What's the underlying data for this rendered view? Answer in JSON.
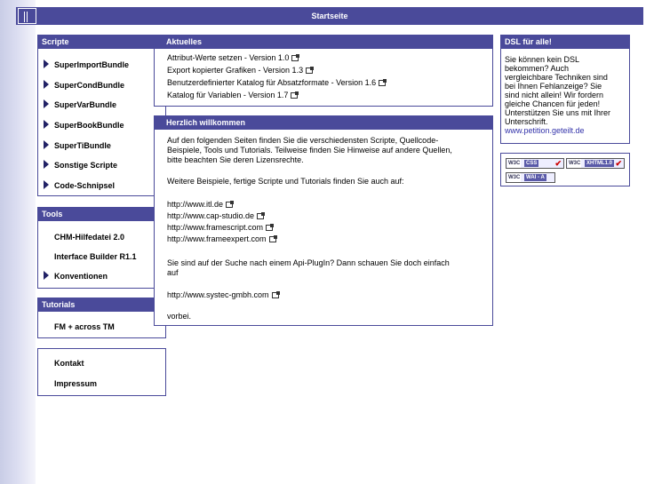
{
  "header": {
    "title": "Startseite"
  },
  "scripte": {
    "heading": "Scripte",
    "items": [
      "SuperImportBundle",
      "SuperCondBundle",
      "SuperVarBundle",
      "SuperBookBundle",
      "SuperTiBundle",
      "Sonstige Scripte",
      "Code-Schnipsel"
    ]
  },
  "tools": {
    "heading": "Tools",
    "items": [
      "CHM-Hilfedatei 2.0",
      "Interface Builder R1.1",
      "Konventionen"
    ]
  },
  "tutorials": {
    "heading": "Tutorials",
    "items": [
      "FM + across TM"
    ]
  },
  "misc": {
    "items": [
      "Kontakt",
      "Impressum"
    ]
  },
  "aktuelles": {
    "heading": "Aktuelles",
    "items": [
      "Attribut-Werte setzen - Version 1.0",
      "Export kopierter Grafiken - Version 1.3",
      "Benutzerdefinierter Katalog für Absatzformate - Version 1.6",
      "Katalog für Variablen - Version 1.7"
    ]
  },
  "willkommen": {
    "heading": "Herzlich willkommen",
    "intro_1": "Auf den folgenden Seiten finden Sie die verschiedensten Scripte, Quellcode-",
    "intro_2": "Beispiele, Tools und Tutorials. Teilweise finden Sie Hinweise auf andere Quellen,",
    "intro_3": "bitte beachten Sie deren Lizensrechte.",
    "more": "Weitere Beispiele, fertige Scripte und Tutorials finden Sie auch auf:",
    "links": [
      "http://www.itl.de",
      "http://www.cap-studio.de",
      "http://www.framescript.com",
      "http://www.frameexpert.com"
    ],
    "plugin_1": "Sie sind auf der Suche nach einem Api-PlugIn? Dann schauen Sie doch einfach",
    "plugin_2": "auf",
    "systec": "http://www.systec-gmbh.com",
    "outro": "vorbei."
  },
  "dsl": {
    "heading": "DSL für alle!",
    "lines": [
      "Sie können kein DSL",
      "bekommen? Auch",
      "vergleichbare Techniken sind",
      "bei Ihnen Fehlanzeige? Sie",
      "sind nicht allein! Wir fordern",
      "gleiche Chancen für jeden!",
      "Unterstützen Sie uns mit Ihrer",
      "Unterschrift."
    ],
    "link": "www.petition.geteilt.de",
    "link_color": "#3333aa"
  },
  "badges": {
    "w3c": "W3C",
    "css": "CSS",
    "xhtml": "XHTML1.0",
    "wai": "WAI - A",
    "check": "✔"
  },
  "colors": {
    "accent": "#4a4a9a"
  }
}
